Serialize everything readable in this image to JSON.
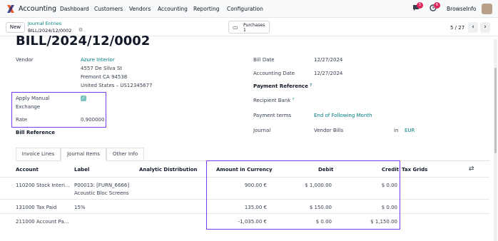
{
  "nav": {
    "app_name": "Accounting",
    "menu": [
      "Dashboard",
      "Customers",
      "Vendors",
      "Accounting",
      "Reporting",
      "Configuration"
    ],
    "messages_badge": "5",
    "activity_badge": "6",
    "company": "BrowseInfo"
  },
  "control": {
    "new_label": "New",
    "breadcrumb_parent": "Journal Entries",
    "breadcrumb_current": "BILL/2024/12/0002",
    "smart_button_label": "Purchases",
    "smart_button_count": "1",
    "pager": "5 / 27"
  },
  "form": {
    "title": "BILL/2024/12/0002",
    "vendor_label": "Vendor",
    "vendor_name": "Azure Interior",
    "vendor_address_1": "4557 De Silva St",
    "vendor_address_2": "Fremont CA 94538",
    "vendor_address_3": "United States – US12345677",
    "apply_manual_label_1": "Apply Manual",
    "apply_manual_label_2": "Exchange",
    "apply_manual_checked": true,
    "rate_label": "Rate",
    "rate_value": "0.900000",
    "bill_reference_label": "Bill Reference",
    "bill_date_label": "Bill Date",
    "bill_date_value": "12/27/2024",
    "accounting_date_label": "Accounting Date",
    "accounting_date_value": "12/27/2024",
    "payment_reference_label": "Payment Reference",
    "recipient_bank_label": "Recipient Bank",
    "payment_terms_label": "Payment terms",
    "payment_terms_value": "End of Following Month",
    "journal_label": "Journal",
    "journal_value": "Vendor Bills",
    "journal_in": "in",
    "currency": "EUR",
    "help_mark": "?"
  },
  "tabs": [
    "Invoice Lines",
    "Journal Items",
    "Other Info"
  ],
  "table": {
    "headers": {
      "account": "Account",
      "label": "Label",
      "analytic": "Analytic Distribution",
      "amount_currency": "Amount in Currency",
      "debit": "Debit",
      "credit": "Credit",
      "tax_grids": "Tax Grids"
    },
    "rows": [
      {
        "account": "110200 Stock Interi...",
        "label_1": "P00013: [FURN_6666]",
        "label_2": "Acoustic Bloc Screens",
        "amount": "900.00 €",
        "debit": "$ 1,000.00",
        "credit": "$ 0.00"
      },
      {
        "account": "131000 Tax Paid",
        "label_1": "15%",
        "label_2": "",
        "amount": "135.00 €",
        "debit": "$ 150.00",
        "credit": "$ 0.00"
      },
      {
        "account": "211000 Account Pa...",
        "label_1": "",
        "label_2": "",
        "amount": "-1,035.00 €",
        "debit": "$ 0.00",
        "credit": "$ 1,150.00"
      }
    ]
  },
  "colors": {
    "accent": "#017e84",
    "highlight": "#7c3aed",
    "badge": "#e0245e"
  }
}
